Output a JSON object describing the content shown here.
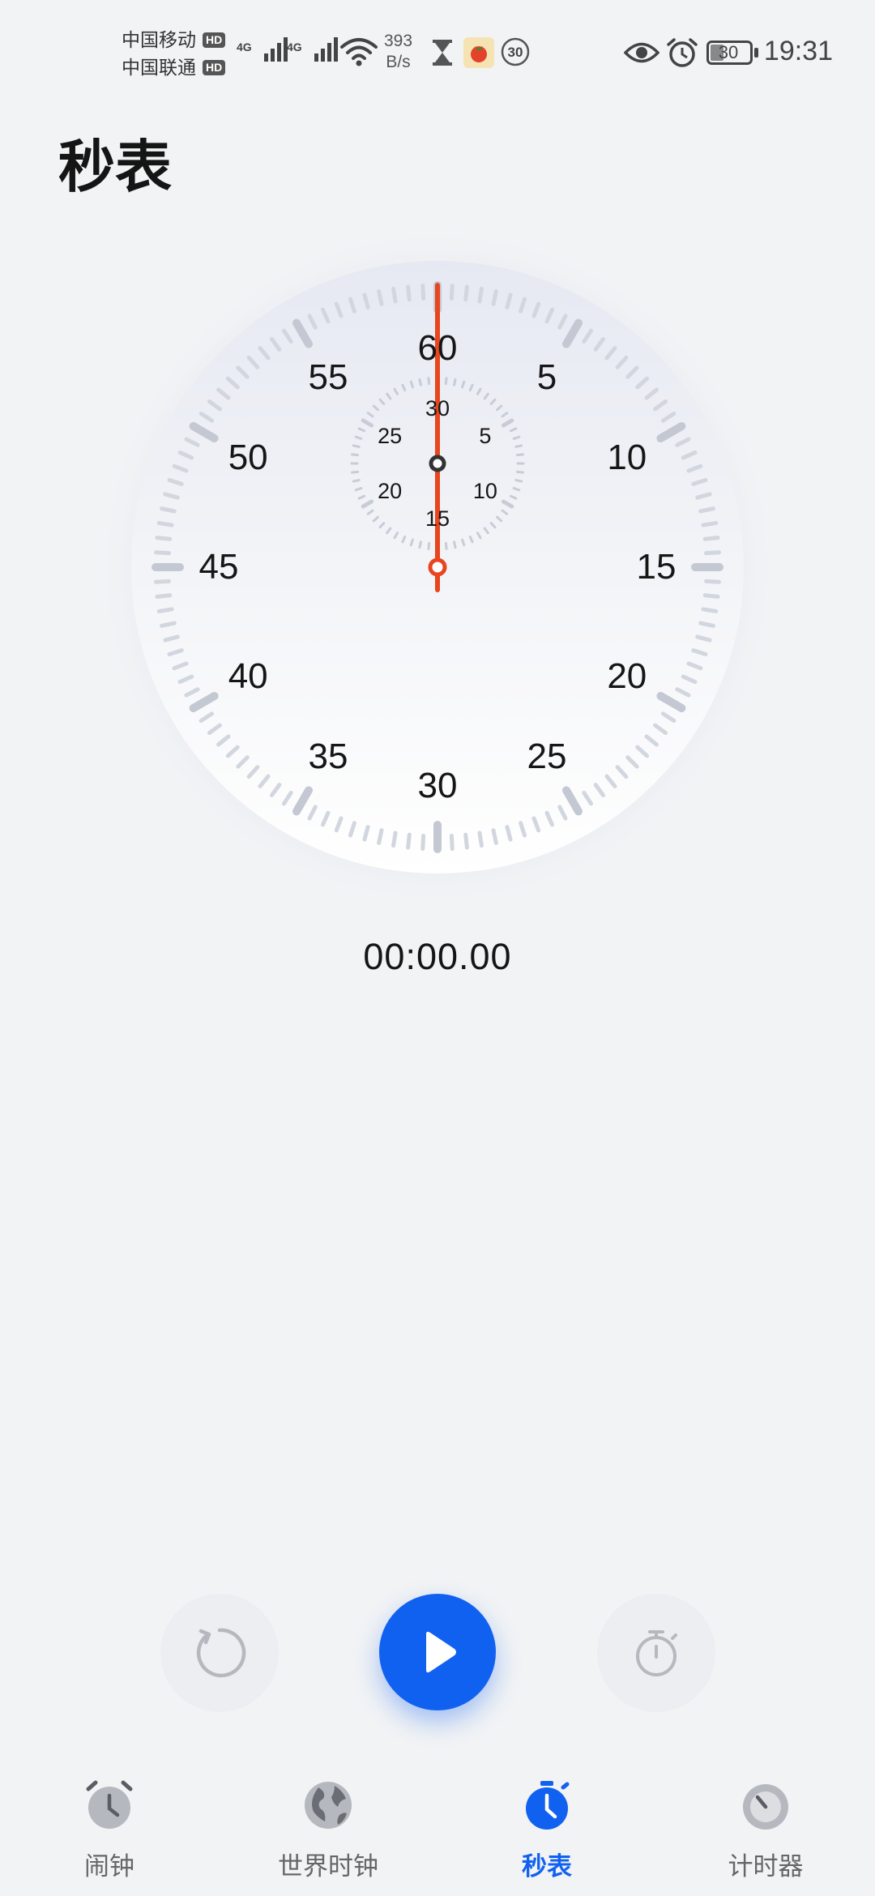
{
  "status_bar": {
    "carrier_1": "中国移动",
    "carrier_2": "中国联通",
    "hd_badge": "HD",
    "network_1": "4G",
    "network_2": "4G",
    "speed_value": "393",
    "speed_unit": "B/s",
    "notification_badge": "30",
    "battery_level": "30",
    "time": "19:31",
    "icons": [
      "signal-icon",
      "wifi-icon",
      "hourglass-icon",
      "tomato-app-icon",
      "eye-icon",
      "alarm-icon",
      "battery-icon"
    ]
  },
  "page": {
    "title": "秒表"
  },
  "stopwatch": {
    "dial_numbers": [
      "60",
      "5",
      "10",
      "15",
      "20",
      "25",
      "30",
      "35",
      "40",
      "45",
      "50",
      "55"
    ],
    "subdial_numbers": [
      "30",
      "5",
      "10",
      "15",
      "20",
      "25"
    ],
    "second_hand_value": 0,
    "elapsed": "00:00.00",
    "colors": {
      "hand": "#e8461e",
      "accent": "#1161f1",
      "tick": "#c7ccd6"
    }
  },
  "controls": {
    "reset_icon": "reset-icon",
    "start_icon": "play-icon",
    "lap_icon": "lap-stopwatch-icon"
  },
  "bottom_nav": {
    "items": [
      {
        "label": "闹钟",
        "icon": "alarm-clock-icon",
        "active": false
      },
      {
        "label": "世界时钟",
        "icon": "globe-icon",
        "active": false
      },
      {
        "label": "秒表",
        "icon": "stopwatch-icon",
        "active": true
      },
      {
        "label": "计时器",
        "icon": "timer-icon",
        "active": false
      }
    ]
  }
}
